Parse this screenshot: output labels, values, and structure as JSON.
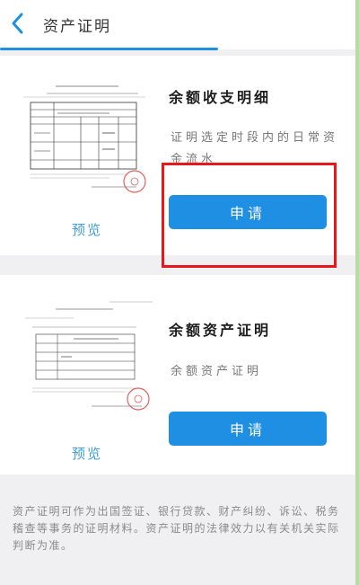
{
  "header": {
    "title": "资产证明",
    "back_icon": "chevron-left-icon"
  },
  "cards": [
    {
      "title": "余额收支明细",
      "description": "证明选定时段内的日常资金流水",
      "preview_label": "预览",
      "apply_label": "申请",
      "thumbnail": "document-thumbnail"
    },
    {
      "title": "余额资产证明",
      "description": "余额资产证明",
      "preview_label": "预览",
      "apply_label": "申请",
      "thumbnail": "document-thumbnail"
    }
  ],
  "footer": {
    "note": "资产证明可作为出国签证、银行贷款、财产纠纷、诉讼、税务稽查等事务的证明材料。资产证明的法律效力以有关机关实际判断为准。"
  },
  "colors": {
    "accent": "#1f8fe3",
    "highlight": "#e8171c",
    "preview_link": "#3f9edb",
    "page_background": "#f0f0f2"
  }
}
